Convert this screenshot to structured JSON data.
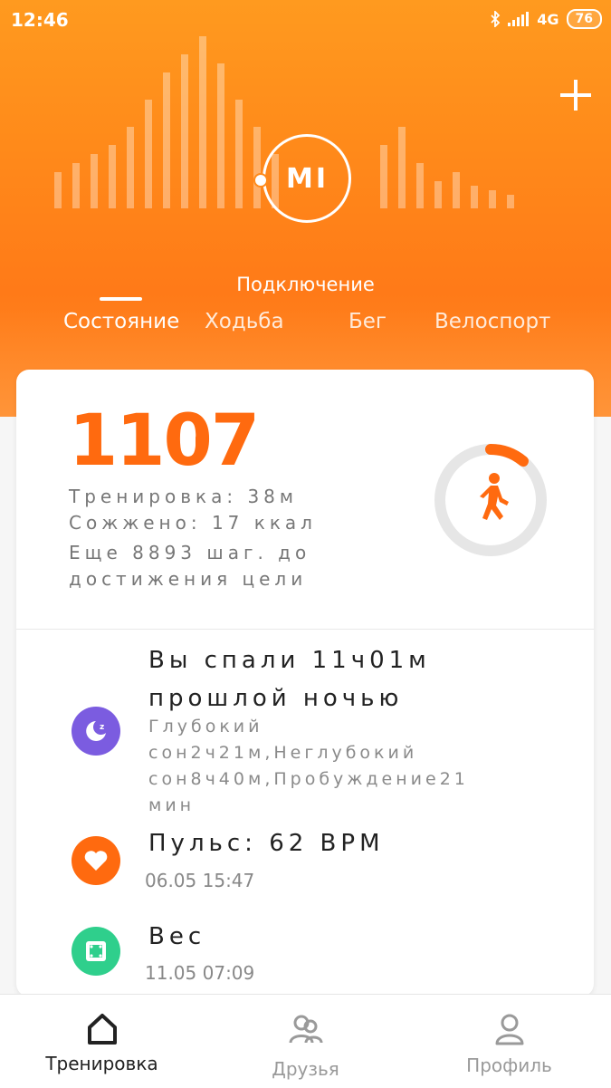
{
  "status": {
    "time": "12:46",
    "network": "4G",
    "battery": "76"
  },
  "header": {
    "connection": "Подключение",
    "tabs": [
      "Состояние",
      "Ходьба",
      "Бег",
      "Велоспорт"
    ],
    "active_tab": "Состояние"
  },
  "steps": {
    "count": "1107",
    "workout": "Тренировка: 38м",
    "burned": "Сожжено: 17 ккал",
    "remaining_line1": "Еще 8893 шаг. до",
    "remaining_line2": "достижения цели",
    "goal_progress": 0.111
  },
  "sleep": {
    "title_line1": "Вы спали 11ч01м",
    "title_line2": "прошлой ночью",
    "detail_line1": "Глубокий",
    "detail_line2": "сон2ч21м,Неглубокий",
    "detail_line3": "сон8ч40м,Пробуждение21",
    "detail_line4": "мин"
  },
  "pulse": {
    "title": "Пульс: 62 BPM",
    "date": "06.05 15:47"
  },
  "weight": {
    "title": "Вес",
    "date": "11.05 07:09"
  },
  "nav": [
    {
      "label": "Тренировка",
      "active": true
    },
    {
      "label": "Друзья",
      "active": false
    },
    {
      "label": "Профиль",
      "active": false
    }
  ],
  "colors": {
    "accent": "#ff6a0f",
    "sleep_icon": "#7b5ce0",
    "pulse_icon": "#ff6a0f",
    "weight_icon": "#2fcf8c"
  }
}
